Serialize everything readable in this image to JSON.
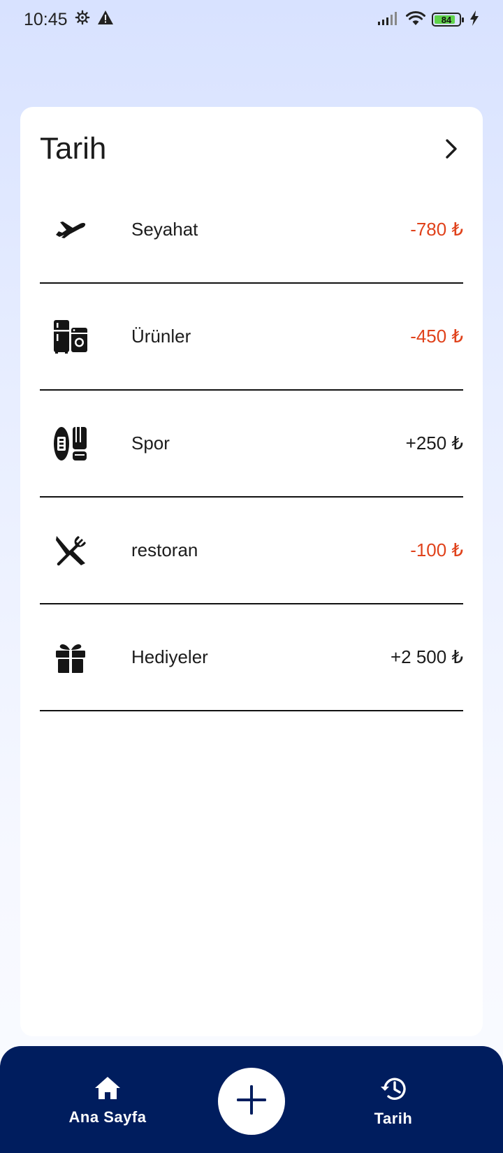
{
  "status_bar": {
    "time": "10:45",
    "battery_level": "84",
    "battery_fraction": 0.84
  },
  "history_card": {
    "title": "Tarih",
    "items": [
      {
        "label": "Seyahat",
        "amount": "-780 ₺",
        "icon": "airplane-icon",
        "type": "expense"
      },
      {
        "label": "Ürünler",
        "amount": "-450 ₺",
        "icon": "appliances-icon",
        "type": "expense"
      },
      {
        "label": "Spor",
        "amount": "+250 ₺",
        "icon": "sports-icon",
        "type": "income"
      },
      {
        "label": "restoran",
        "amount": "-100 ₺",
        "icon": "cutlery-icon",
        "type": "expense"
      },
      {
        "label": "Hediyeler",
        "amount": "+2 500 ₺",
        "icon": "gift-icon",
        "type": "income"
      }
    ]
  },
  "bottom_nav": {
    "home_label": "Ana Sayfa",
    "history_label": "Tarih"
  },
  "colors": {
    "expense": "#e0421b",
    "income": "#1c1c1c",
    "nav_background": "#001d5e"
  }
}
